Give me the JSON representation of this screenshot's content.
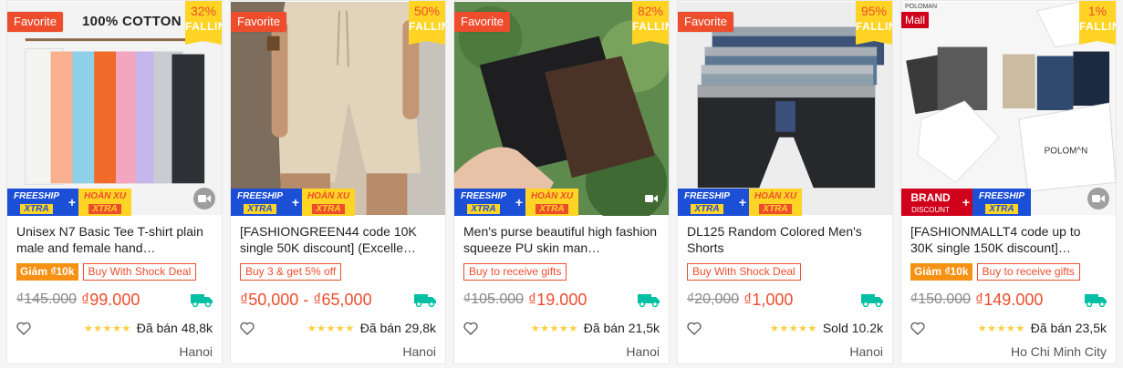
{
  "products": [
    {
      "badge": "Favorite",
      "overlay_text": "100% COTTON",
      "discount_pct": "32%",
      "discount_word": "FALLING",
      "shipping": [
        "FREESHIP",
        "XTRA",
        "HOÀN XU",
        "XTRA"
      ],
      "title": "Unisex N7 Basic Tee T-shirt plain male and female hand…",
      "tags": [
        "Giảm ₫10k",
        "Buy With Shock Deal"
      ],
      "old_price": "₫145.000",
      "price": "₫99.000",
      "rating": "★★★★★",
      "sold": "Đã bán 48,8k",
      "location": "Hanoi"
    },
    {
      "badge": "Favorite",
      "discount_pct": "50%",
      "discount_word": "FALLING",
      "shipping": [
        "FREESHIP",
        "XTRA",
        "HOÀN XU",
        "XTRA"
      ],
      "title": "[FASHIONGREEN44 code 10K single 50K discount] (Excelle…",
      "tags": [
        "Buy 3 & get 5% off"
      ],
      "old_price": "",
      "price": "₫50,000 - ₫65,000",
      "rating": "★★★★★",
      "sold": "Đã bán 29,8k",
      "location": "Hanoi"
    },
    {
      "badge": "Favorite",
      "discount_pct": "82%",
      "discount_word": "FALLING",
      "shipping": [
        "FREESHIP",
        "XTRA",
        "HOÀN XU",
        "XTRA"
      ],
      "title": "Men's purse beautiful high fashion squeeze PU skin man…",
      "tags": [
        "Buy to receive gifts"
      ],
      "old_price": "₫105.000",
      "price": "₫19.000",
      "rating": "★★★★★",
      "sold": "Đã bán 21,5k",
      "location": "Hanoi"
    },
    {
      "badge": "Favorite",
      "discount_pct": "95%",
      "discount_word": "FALLING",
      "shipping": [
        "FREESHIP",
        "XTRA",
        "HOÀN XU",
        "XTRA"
      ],
      "title": "DL125 Random Colored Men's Shorts",
      "tags": [
        "Buy With Shock Deal"
      ],
      "old_price": "₫20,000",
      "price": "₫1,000",
      "rating": "★★★★★",
      "sold": "Sold 10.2k",
      "location": "Hanoi"
    },
    {
      "badge": "Mall",
      "brand_top": "POLOMAN",
      "discount_pct": "1%",
      "discount_word": "FALLING",
      "shipping": [
        "BRAND",
        "DISCOUNT",
        "FREESHIP",
        "XTRA"
      ],
      "box_brand": "POLOM^N",
      "title": "[FASHIONMALLT4 code up to 30K single 150K discount]…",
      "tags": [
        "Giảm ₫10k",
        "Buy to receive gifts"
      ],
      "old_price": "₫150.000",
      "price": "₫149.000",
      "rating": "★★★★★",
      "sold": "Đã bán 23,5k",
      "location": "Ho Chi Minh City"
    }
  ],
  "colors": {
    "accent": "#ee4d2d",
    "discount_bg": "#ffd424",
    "star": "#ffce3d",
    "freeship": "#1a4fd6"
  }
}
